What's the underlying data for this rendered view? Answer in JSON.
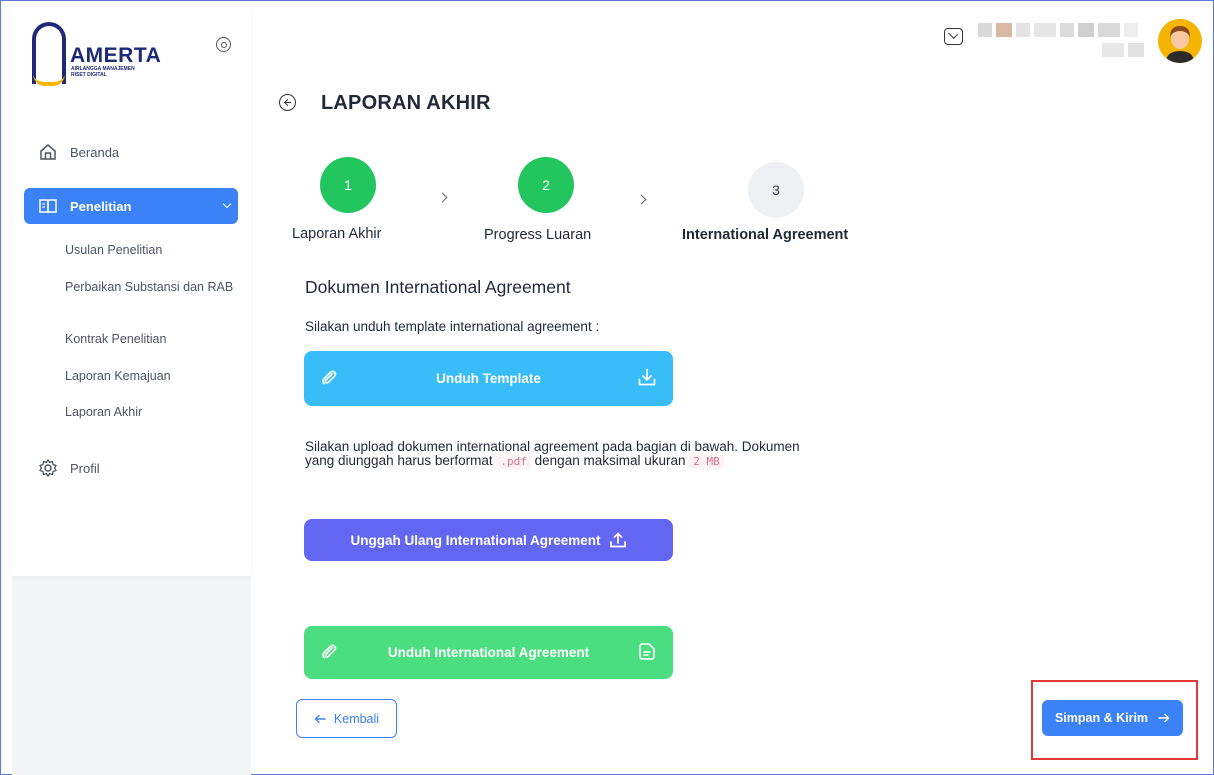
{
  "brand": {
    "name": "AMERTA",
    "tagline_line1": "AIRLANGGA MANAJEMEN",
    "tagline_line2": "RISET DIGITAL",
    "colors": {
      "navy": "#1e2a78",
      "gold": "#f5b400"
    }
  },
  "sidebar": {
    "items": [
      {
        "label": "Beranda",
        "icon": "home-icon"
      },
      {
        "label": "Penelitian",
        "icon": "book-icon",
        "active": true
      },
      {
        "label": "Profil",
        "icon": "gear-icon"
      }
    ],
    "sub_items": [
      {
        "label": "Usulan Penelitian"
      },
      {
        "label": "Perbaikan Substansi dan RAB"
      },
      {
        "label": "Kontrak Penelitian"
      },
      {
        "label": "Laporan Kemajuan"
      },
      {
        "label": "Laporan Akhir"
      }
    ]
  },
  "header": {
    "mail_icon": "mail-icon",
    "avatar_icon": "user-avatar"
  },
  "page": {
    "title": "LAPORAN AKHIR",
    "steps": [
      {
        "number": "1",
        "label": "Laporan Akhir",
        "status": "done"
      },
      {
        "number": "2",
        "label": "Progress Luaran",
        "status": "done"
      },
      {
        "number": "3",
        "label": "International Agreement",
        "status": "current"
      }
    ],
    "section_title": "Dokumen International Agreement",
    "download_instruction": "Silakan unduh template international agreement :",
    "download_template_label": "Unduh Template",
    "upload_instruction_1": "Silakan upload dokumen international agreement pada bagian di bawah. Dokumen",
    "upload_instruction_2a": "yang diunggah harus berformat",
    "format_chip": ".pdf",
    "upload_instruction_2b": "dengan maksimal ukuran",
    "size_chip": "2 MB",
    "reupload_label": "Unggah Ulang International Agreement",
    "download_agreement_label": "Unduh International Agreement",
    "back_label": "Kembali",
    "submit_label": "Simpan & Kirim"
  },
  "colors": {
    "primary": "#3b82f6",
    "success": "#22c55e",
    "sky": "#38bdf8",
    "purple": "#6366f1",
    "green_button": "#4ade80",
    "highlight": "#e53935"
  }
}
